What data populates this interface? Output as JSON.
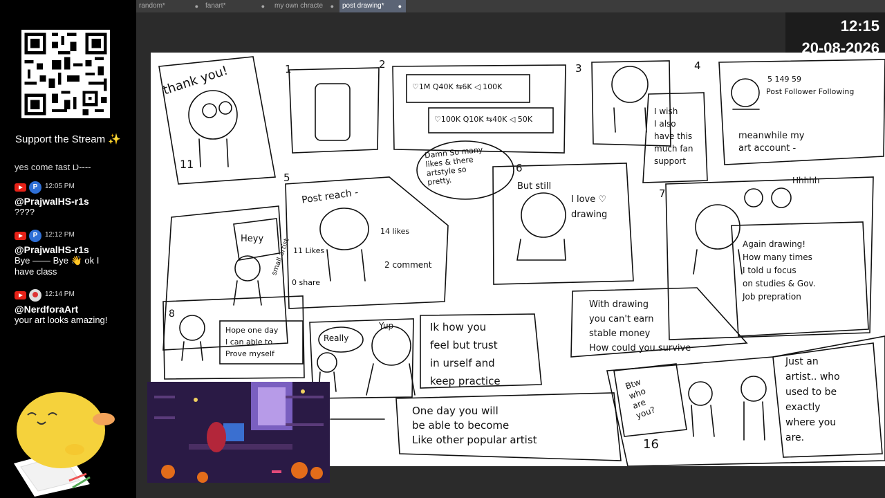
{
  "sidebar": {
    "support_text": "Support the Stream ✨",
    "chat": {
      "cut_text": "yes come fast D----",
      "messages": [
        {
          "avatar": "P",
          "time": "12:05 PM",
          "user": "@PrajwalHS-r1s",
          "text": "????"
        },
        {
          "avatar": "P",
          "time": "12:12 PM",
          "user": "@PrajwalHS-r1s",
          "text": "Bye —— Bye 👋 ok I have class"
        },
        {
          "avatar": "",
          "time": "12:14 PM",
          "user": "@NerdforaArt",
          "text": "your art looks amazing!"
        }
      ]
    }
  },
  "tabs": [
    {
      "label": "random*",
      "close": "●"
    },
    {
      "label": "fanart*",
      "close": "●"
    },
    {
      "label": "my own chracte",
      "close": "●"
    },
    {
      "label": "post drawing*",
      "close": "●"
    }
  ],
  "clock": {
    "time": "12:15",
    "date": "20-08-2026"
  },
  "comic": {
    "p1_thanks": "thank you!",
    "p1_num": "11",
    "n1": "1",
    "n2": "2",
    "n3": "3",
    "n4": "4",
    "n5": "5",
    "n6": "6",
    "n7": "7",
    "n8": "8",
    "n16": "16",
    "p2_row1": "♡1M  Q40K  ⇆6K  ◁ 100K",
    "p2_row2": "♡100K  Q10K  ⇆40K  ◁ 50K",
    "bubble_damn": [
      "Damn So many",
      "likes & there",
      "artstyle so",
      "pretty."
    ],
    "p3_wish": [
      "I wish",
      "I also",
      "have this",
      "much fan",
      "support"
    ],
    "p4_stats": "5     149     59",
    "p4_labels": "Post  Follower Following",
    "p4_meanwhile": [
      "meanwhile my",
      "art account -"
    ],
    "p5_title": "Post reach -",
    "p5_likes": "11 Likes",
    "p5_likes2": "14 likes",
    "p5_comment": "2 comment",
    "p5_share": "0 share",
    "p5_hey": "Heyy",
    "p5_small": "small artist",
    "p6_but": "But still",
    "p6_love": [
      "I love ♡",
      "drawing"
    ],
    "p7_hhh": "Hhhhh",
    "p7_again": [
      "Again drawing!",
      "How many times",
      "I told u focus",
      "on studies & Gov.",
      "Job prepration"
    ],
    "p7_with": [
      "With drawing",
      "you can't earn",
      "stable money",
      "How could you survive"
    ],
    "p8_hope": [
      "Hope one day",
      "I can able to",
      "Prove myself"
    ],
    "p8_really": "Really",
    "p8_yup": "Yup",
    "p8_ik": [
      "Ik how you",
      "feel but trust",
      "in urself and",
      "keep practice"
    ],
    "p8_oneday": [
      "One day you will",
      "be able to become",
      "Like other popular artist"
    ],
    "p16_btw": [
      "Btw",
      "who",
      "are",
      "you?"
    ],
    "p16_just": [
      "Just an",
      "artist.. who",
      "used to be",
      "exactly",
      "where you",
      "are."
    ]
  }
}
